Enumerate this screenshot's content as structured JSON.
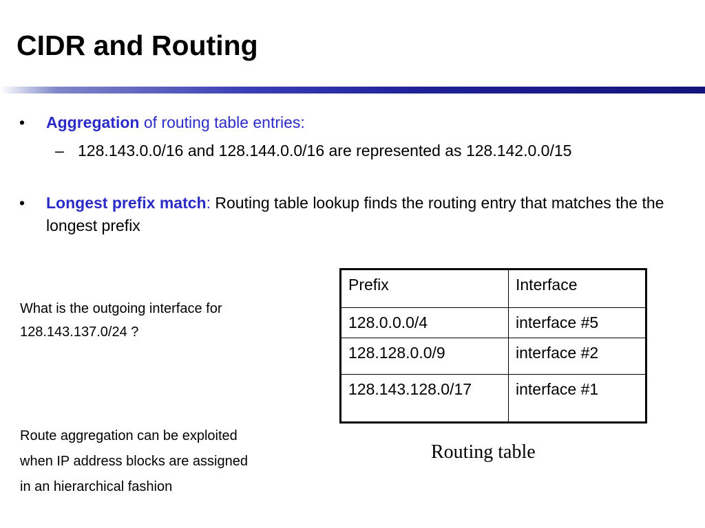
{
  "slide": {
    "title": "CIDR and Routing"
  },
  "bullets": [
    {
      "marker": "•",
      "keyword": "Aggregation",
      "text": " of routing table entries:"
    },
    {
      "marker": "–",
      "text": "128.143.0.0/16 and 128.144.0.0/16 are represented as 128.142.0.0/15"
    },
    {
      "marker": "•",
      "keyword": "Longest prefix match",
      "separator": ":",
      "text": " Routing table lookup finds the routing entry that matches the the longest prefix"
    }
  ],
  "question": {
    "line1": "What is the outgoing interface for",
    "line2": "128.143.137.0/24 ?"
  },
  "aggregation_note": {
    "line1": "Route aggregation can be exploited",
    "line2": "when IP address blocks are assigned",
    "line3": "in an hierarchical fashion"
  },
  "routing_table": {
    "headers": [
      "Prefix",
      "Interface"
    ],
    "rows": [
      [
        "128.0.0.0/4",
        "interface #5"
      ],
      [
        "128.128.0.0/9",
        "interface #2"
      ],
      [
        "128.143.128.0/17",
        "interface #1"
      ]
    ],
    "caption": "Routing table"
  },
  "colors": {
    "keyword": "#2b2bc7",
    "title_rule": "#1e2196"
  }
}
